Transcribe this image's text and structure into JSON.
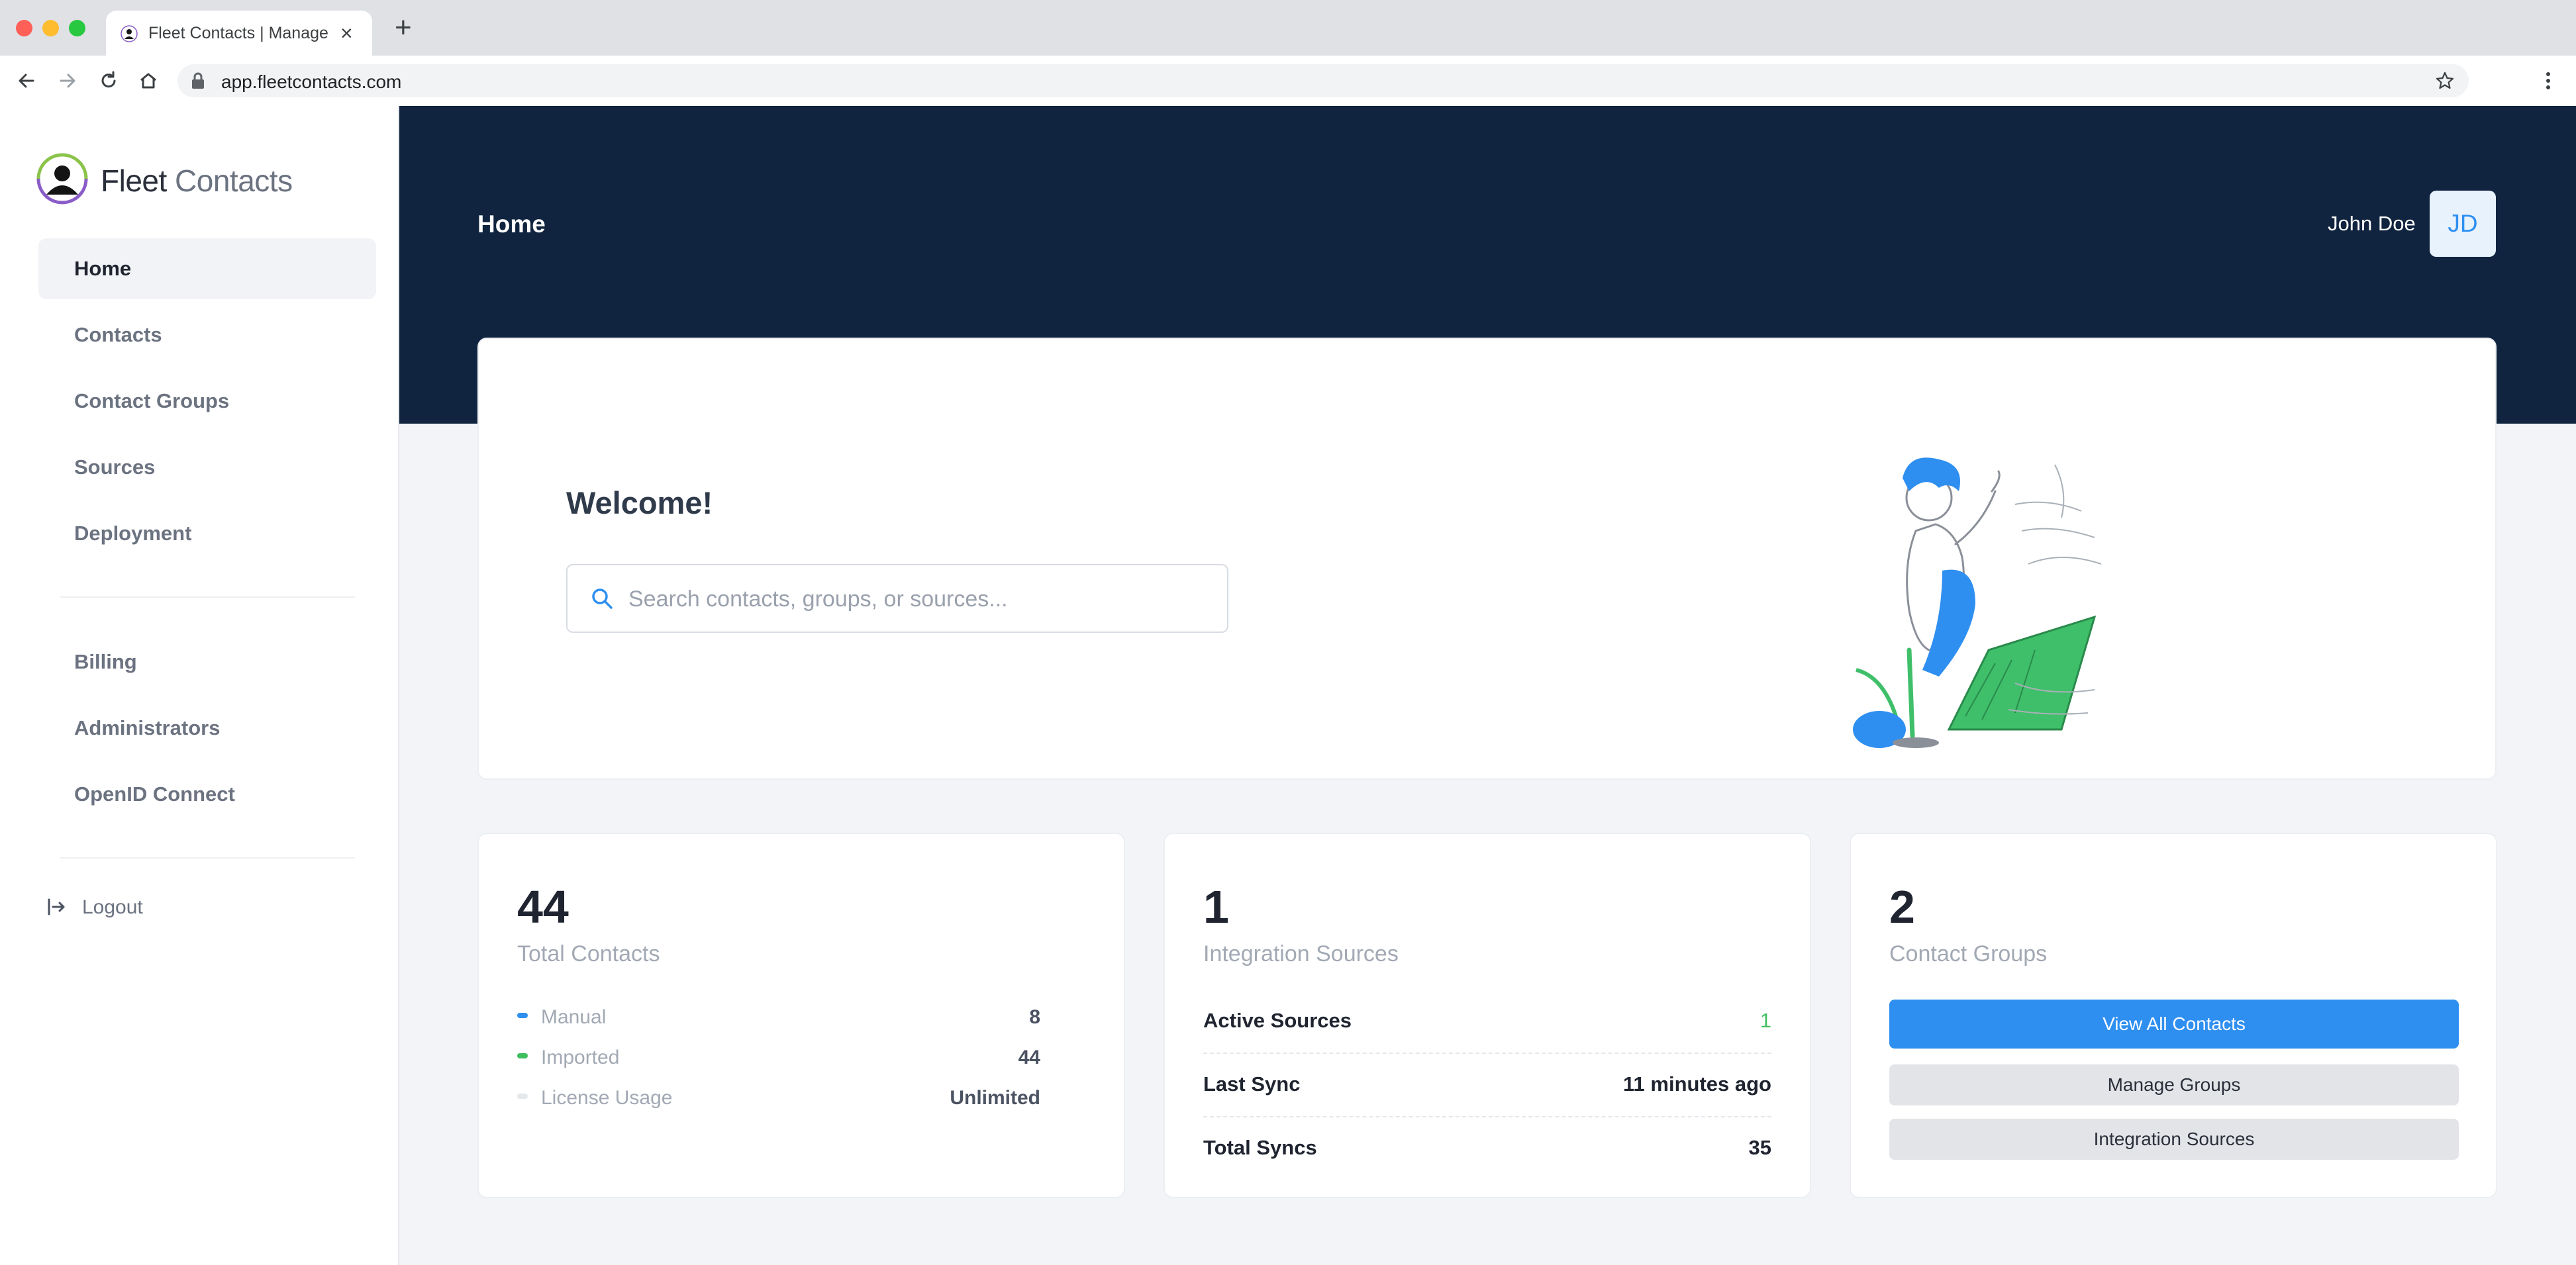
{
  "browser": {
    "tab_title": "Fleet Contacts | Manage",
    "url": "app.fleetcontacts.com",
    "new_tab_symbol": "+",
    "close_symbol": "×"
  },
  "sidebar": {
    "brand": {
      "name_primary": "Fleet",
      "name_secondary": "Contacts"
    },
    "nav_primary": [
      {
        "label": "Home",
        "active": true
      },
      {
        "label": "Contacts",
        "active": false
      },
      {
        "label": "Contact Groups",
        "active": false
      },
      {
        "label": "Sources",
        "active": false
      },
      {
        "label": "Deployment",
        "active": false
      }
    ],
    "nav_secondary": [
      {
        "label": "Billing"
      },
      {
        "label": "Administrators"
      },
      {
        "label": "OpenID Connect"
      }
    ],
    "logout_label": "Logout"
  },
  "header": {
    "page_title": "Home",
    "user_name": "John Doe",
    "user_initials": "JD"
  },
  "welcome": {
    "title": "Welcome!",
    "search_placeholder": "Search contacts, groups, or sources...",
    "search_value": ""
  },
  "stats": {
    "contacts": {
      "number": "44",
      "label": "Total Contacts",
      "breakdown": [
        {
          "label": "Manual",
          "value": "8",
          "color": "#2e8ff0"
        },
        {
          "label": "Imported",
          "value": "44",
          "color": "#3fbf5f"
        },
        {
          "label": "License Usage",
          "value": "Unlimited",
          "color": "#e4e7ec"
        }
      ]
    },
    "sources": {
      "number": "1",
      "label": "Integration Sources",
      "rows": [
        {
          "label": "Active Sources",
          "value": "1"
        },
        {
          "label": "Last Sync",
          "value": "11 minutes ago"
        },
        {
          "label": "Total Syncs",
          "value": "35"
        }
      ]
    },
    "groups": {
      "number": "2",
      "label": "Contact Groups",
      "buttons": {
        "view_all": "View All Contacts",
        "manage_groups": "Manage Groups",
        "integration_sources": "Integration Sources"
      }
    }
  },
  "colors": {
    "navy": "#10243f",
    "accent": "#2e8ff0",
    "success": "#3fbf5f"
  }
}
